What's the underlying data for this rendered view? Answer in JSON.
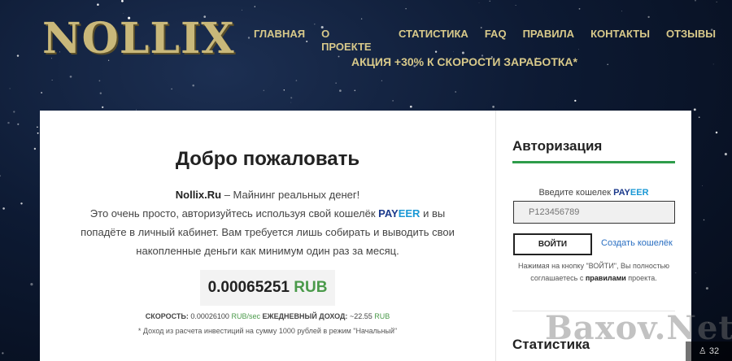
{
  "header": {
    "logo": "NOLLIX",
    "nav": [
      "ГЛАВНАЯ",
      "О ПРОЕКТЕ",
      "СТАТИСТИКА",
      "FAQ",
      "ПРАВИЛА",
      "КОНТАКТЫ",
      "ОТЗЫВЫ"
    ],
    "promo": "АКЦИЯ +30% К СКОРОСТИ ЗАРАБОТКА*"
  },
  "main": {
    "title": "Добро пожаловать",
    "site_name": "Nollix.Ru",
    "tagline": " – Майнинг реальных денег!",
    "desc_1": "Это очень просто, авторизуйтесь используя свой кошелёк ",
    "payeer_part1": "PAY",
    "payeer_part2": "EER",
    "desc_2": " и вы попадёте в личный кабинет. Вам требуется лишь собирать и выводить свои накопленные деньги как минимум один раз за месяц.",
    "balance_value": "0.00065251",
    "balance_currency": "RUB",
    "speed_label": "СКОРОСТЬ:",
    "speed_value": " 0.00026100 ",
    "speed_unit": "RUB/sec",
    "daily_label": " ЕЖЕДНЕВНЫЙ ДОХОД:",
    "daily_value": " ~22.55 ",
    "daily_unit": "RUB",
    "note": "* Доход из расчета инвестиций на сумму 1000 рублей в режим \"Начальный\""
  },
  "sidebar": {
    "auth_title": "Авторизация",
    "wallet_label": "Введите кошелек ",
    "wallet_placeholder": "P123456789",
    "login_button": "ВОЙТИ",
    "create_wallet_link": "Создать кошелёк",
    "terms_1": "Нажимая на кнопку \"ВОЙТИ\", Вы полностью соглашаетесь с ",
    "terms_bold": "правилами",
    "terms_2": " проекта.",
    "stats_title": "Статистика"
  },
  "overlay": {
    "watermark": "Baxov.Net",
    "counter": "32",
    "counter_icon": "user-icon"
  },
  "colors": {
    "accent_green": "#2e9c4a",
    "gold": "#d8c98a",
    "payeer_dark": "#1b3a8c",
    "payeer_light": "#1a98d5"
  }
}
